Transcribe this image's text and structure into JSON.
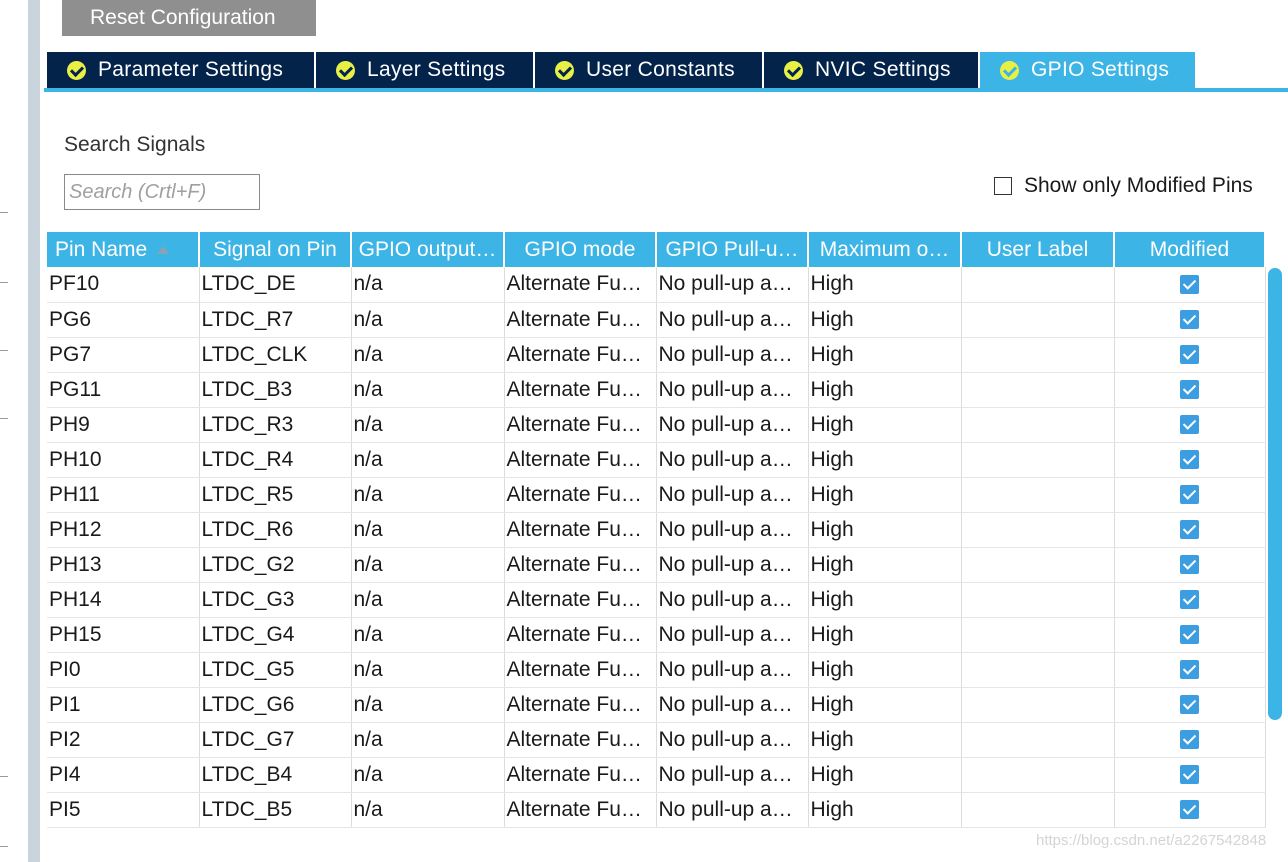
{
  "toolbar": {
    "reset_label": "Reset Configuration"
  },
  "tabs": [
    {
      "label": "Parameter Settings",
      "active": false
    },
    {
      "label": "Layer Settings",
      "active": false
    },
    {
      "label": "User Constants",
      "active": false
    },
    {
      "label": "NVIC Settings",
      "active": false
    },
    {
      "label": "GPIO Settings",
      "active": true
    }
  ],
  "search": {
    "label": "Search Signals",
    "placeholder": "Search (Crtl+F)",
    "value": ""
  },
  "filter": {
    "show_modified_label": "Show only Modified Pins",
    "checked": false
  },
  "table": {
    "columns": [
      "Pin Name",
      "Signal on Pin",
      "GPIO output…",
      "GPIO mode",
      "GPIO Pull-u…",
      "Maximum o…",
      "User Label",
      "Modified"
    ],
    "sorted_column": "Pin Name",
    "rows": [
      {
        "pin": "PF10",
        "signal": "LTDC_DE",
        "output": "n/a",
        "mode": "Alternate Fu…",
        "pull": "No pull-up a…",
        "speed": "High",
        "label": "",
        "modified": true
      },
      {
        "pin": "PG6",
        "signal": "LTDC_R7",
        "output": "n/a",
        "mode": "Alternate Fu…",
        "pull": "No pull-up a…",
        "speed": "High",
        "label": "",
        "modified": true
      },
      {
        "pin": "PG7",
        "signal": "LTDC_CLK",
        "output": "n/a",
        "mode": "Alternate Fu…",
        "pull": "No pull-up a…",
        "speed": "High",
        "label": "",
        "modified": true
      },
      {
        "pin": "PG11",
        "signal": "LTDC_B3",
        "output": "n/a",
        "mode": "Alternate Fu…",
        "pull": "No pull-up a…",
        "speed": "High",
        "label": "",
        "modified": true
      },
      {
        "pin": "PH9",
        "signal": "LTDC_R3",
        "output": "n/a",
        "mode": "Alternate Fu…",
        "pull": "No pull-up a…",
        "speed": "High",
        "label": "",
        "modified": true
      },
      {
        "pin": "PH10",
        "signal": "LTDC_R4",
        "output": "n/a",
        "mode": "Alternate Fu…",
        "pull": "No pull-up a…",
        "speed": "High",
        "label": "",
        "modified": true
      },
      {
        "pin": "PH11",
        "signal": "LTDC_R5",
        "output": "n/a",
        "mode": "Alternate Fu…",
        "pull": "No pull-up a…",
        "speed": "High",
        "label": "",
        "modified": true
      },
      {
        "pin": "PH12",
        "signal": "LTDC_R6",
        "output": "n/a",
        "mode": "Alternate Fu…",
        "pull": "No pull-up a…",
        "speed": "High",
        "label": "",
        "modified": true
      },
      {
        "pin": "PH13",
        "signal": "LTDC_G2",
        "output": "n/a",
        "mode": "Alternate Fu…",
        "pull": "No pull-up a…",
        "speed": "High",
        "label": "",
        "modified": true
      },
      {
        "pin": "PH14",
        "signal": "LTDC_G3",
        "output": "n/a",
        "mode": "Alternate Fu…",
        "pull": "No pull-up a…",
        "speed": "High",
        "label": "",
        "modified": true
      },
      {
        "pin": "PH15",
        "signal": "LTDC_G4",
        "output": "n/a",
        "mode": "Alternate Fu…",
        "pull": "No pull-up a…",
        "speed": "High",
        "label": "",
        "modified": true
      },
      {
        "pin": "PI0",
        "signal": "LTDC_G5",
        "output": "n/a",
        "mode": "Alternate Fu…",
        "pull": "No pull-up a…",
        "speed": "High",
        "label": "",
        "modified": true
      },
      {
        "pin": "PI1",
        "signal": "LTDC_G6",
        "output": "n/a",
        "mode": "Alternate Fu…",
        "pull": "No pull-up a…",
        "speed": "High",
        "label": "",
        "modified": true
      },
      {
        "pin": "PI2",
        "signal": "LTDC_G7",
        "output": "n/a",
        "mode": "Alternate Fu…",
        "pull": "No pull-up a…",
        "speed": "High",
        "label": "",
        "modified": true
      },
      {
        "pin": "PI4",
        "signal": "LTDC_B4",
        "output": "n/a",
        "mode": "Alternate Fu…",
        "pull": "No pull-up a…",
        "speed": "High",
        "label": "",
        "modified": true
      },
      {
        "pin": "PI5",
        "signal": "LTDC_B5",
        "output": "n/a",
        "mode": "Alternate Fu…",
        "pull": "No pull-up a…",
        "speed": "High",
        "label": "",
        "modified": true
      }
    ]
  },
  "watermark": "https://blog.csdn.net/a2267542848",
  "colors": {
    "tab_dark": "#03234b",
    "accent": "#3cb4e6",
    "check": "#e8f046",
    "checkbox": "#3c9ee0"
  }
}
